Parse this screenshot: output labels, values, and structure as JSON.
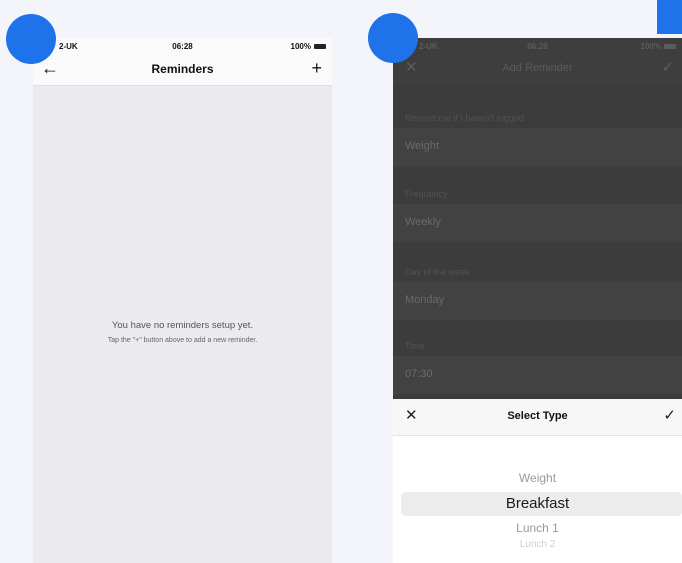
{
  "colors": {
    "accent": "#1f73ea",
    "overlay": "#3c3c3c"
  },
  "left_screen": {
    "status": {
      "carrier": "2-UK",
      "time": "06:28",
      "battery": "100%"
    },
    "nav": {
      "back_icon": "back-arrow-icon",
      "title": "Reminders",
      "add_icon": "plus-icon"
    },
    "empty_title": "You have no reminders setup yet.",
    "empty_hint": "Tap the \"+\" button above to add a new reminder."
  },
  "right_screen": {
    "status": {
      "carrier": "2-UK",
      "time": "06:28",
      "battery": "100%"
    },
    "nav": {
      "close_icon": "close-icon",
      "title": "Add Reminder",
      "confirm_icon": "check-icon"
    },
    "fields": [
      {
        "label": "Remind me if I haven't logged",
        "value": "Weight"
      },
      {
        "label": "Frequency",
        "value": "Weekly"
      },
      {
        "label": "Day of the week",
        "value": "Monday"
      },
      {
        "label": "Time",
        "value": "07:30"
      }
    ],
    "sheet": {
      "title": "Select Type",
      "cancel_icon": "close-icon",
      "done_icon": "check-icon",
      "options": [
        "Weight",
        "Breakfast",
        "Lunch 1",
        "Lunch 2"
      ],
      "selected": "Breakfast"
    }
  }
}
